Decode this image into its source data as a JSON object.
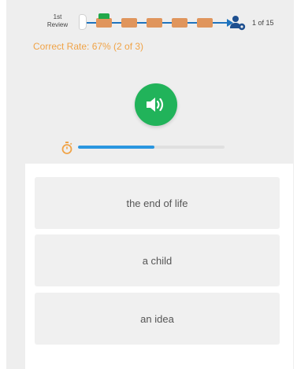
{
  "header": {
    "review_label": "1st\nReview",
    "counter": "1 of 15",
    "correct_rate": "Correct Rate: 67% (2 of 3)"
  },
  "progress": {
    "total_cards_shown": 5,
    "current_index": 0
  },
  "timer": {
    "fill_fraction": 0.52
  },
  "options": [
    {
      "label": "the end of life"
    },
    {
      "label": "a child"
    },
    {
      "label": "an idea"
    }
  ],
  "colors": {
    "background": "#eeeeee",
    "accent_orange": "#f0a347",
    "audio_green": "#21b35a",
    "track_blue": "#1e73be",
    "timer_blue": "#2a96e0",
    "card_orange": "#e0955c",
    "current_green": "#22a84a"
  },
  "icons": {
    "audio": "speaker-icon",
    "timer": "stopwatch-icon",
    "user": "user-settings-icon"
  }
}
